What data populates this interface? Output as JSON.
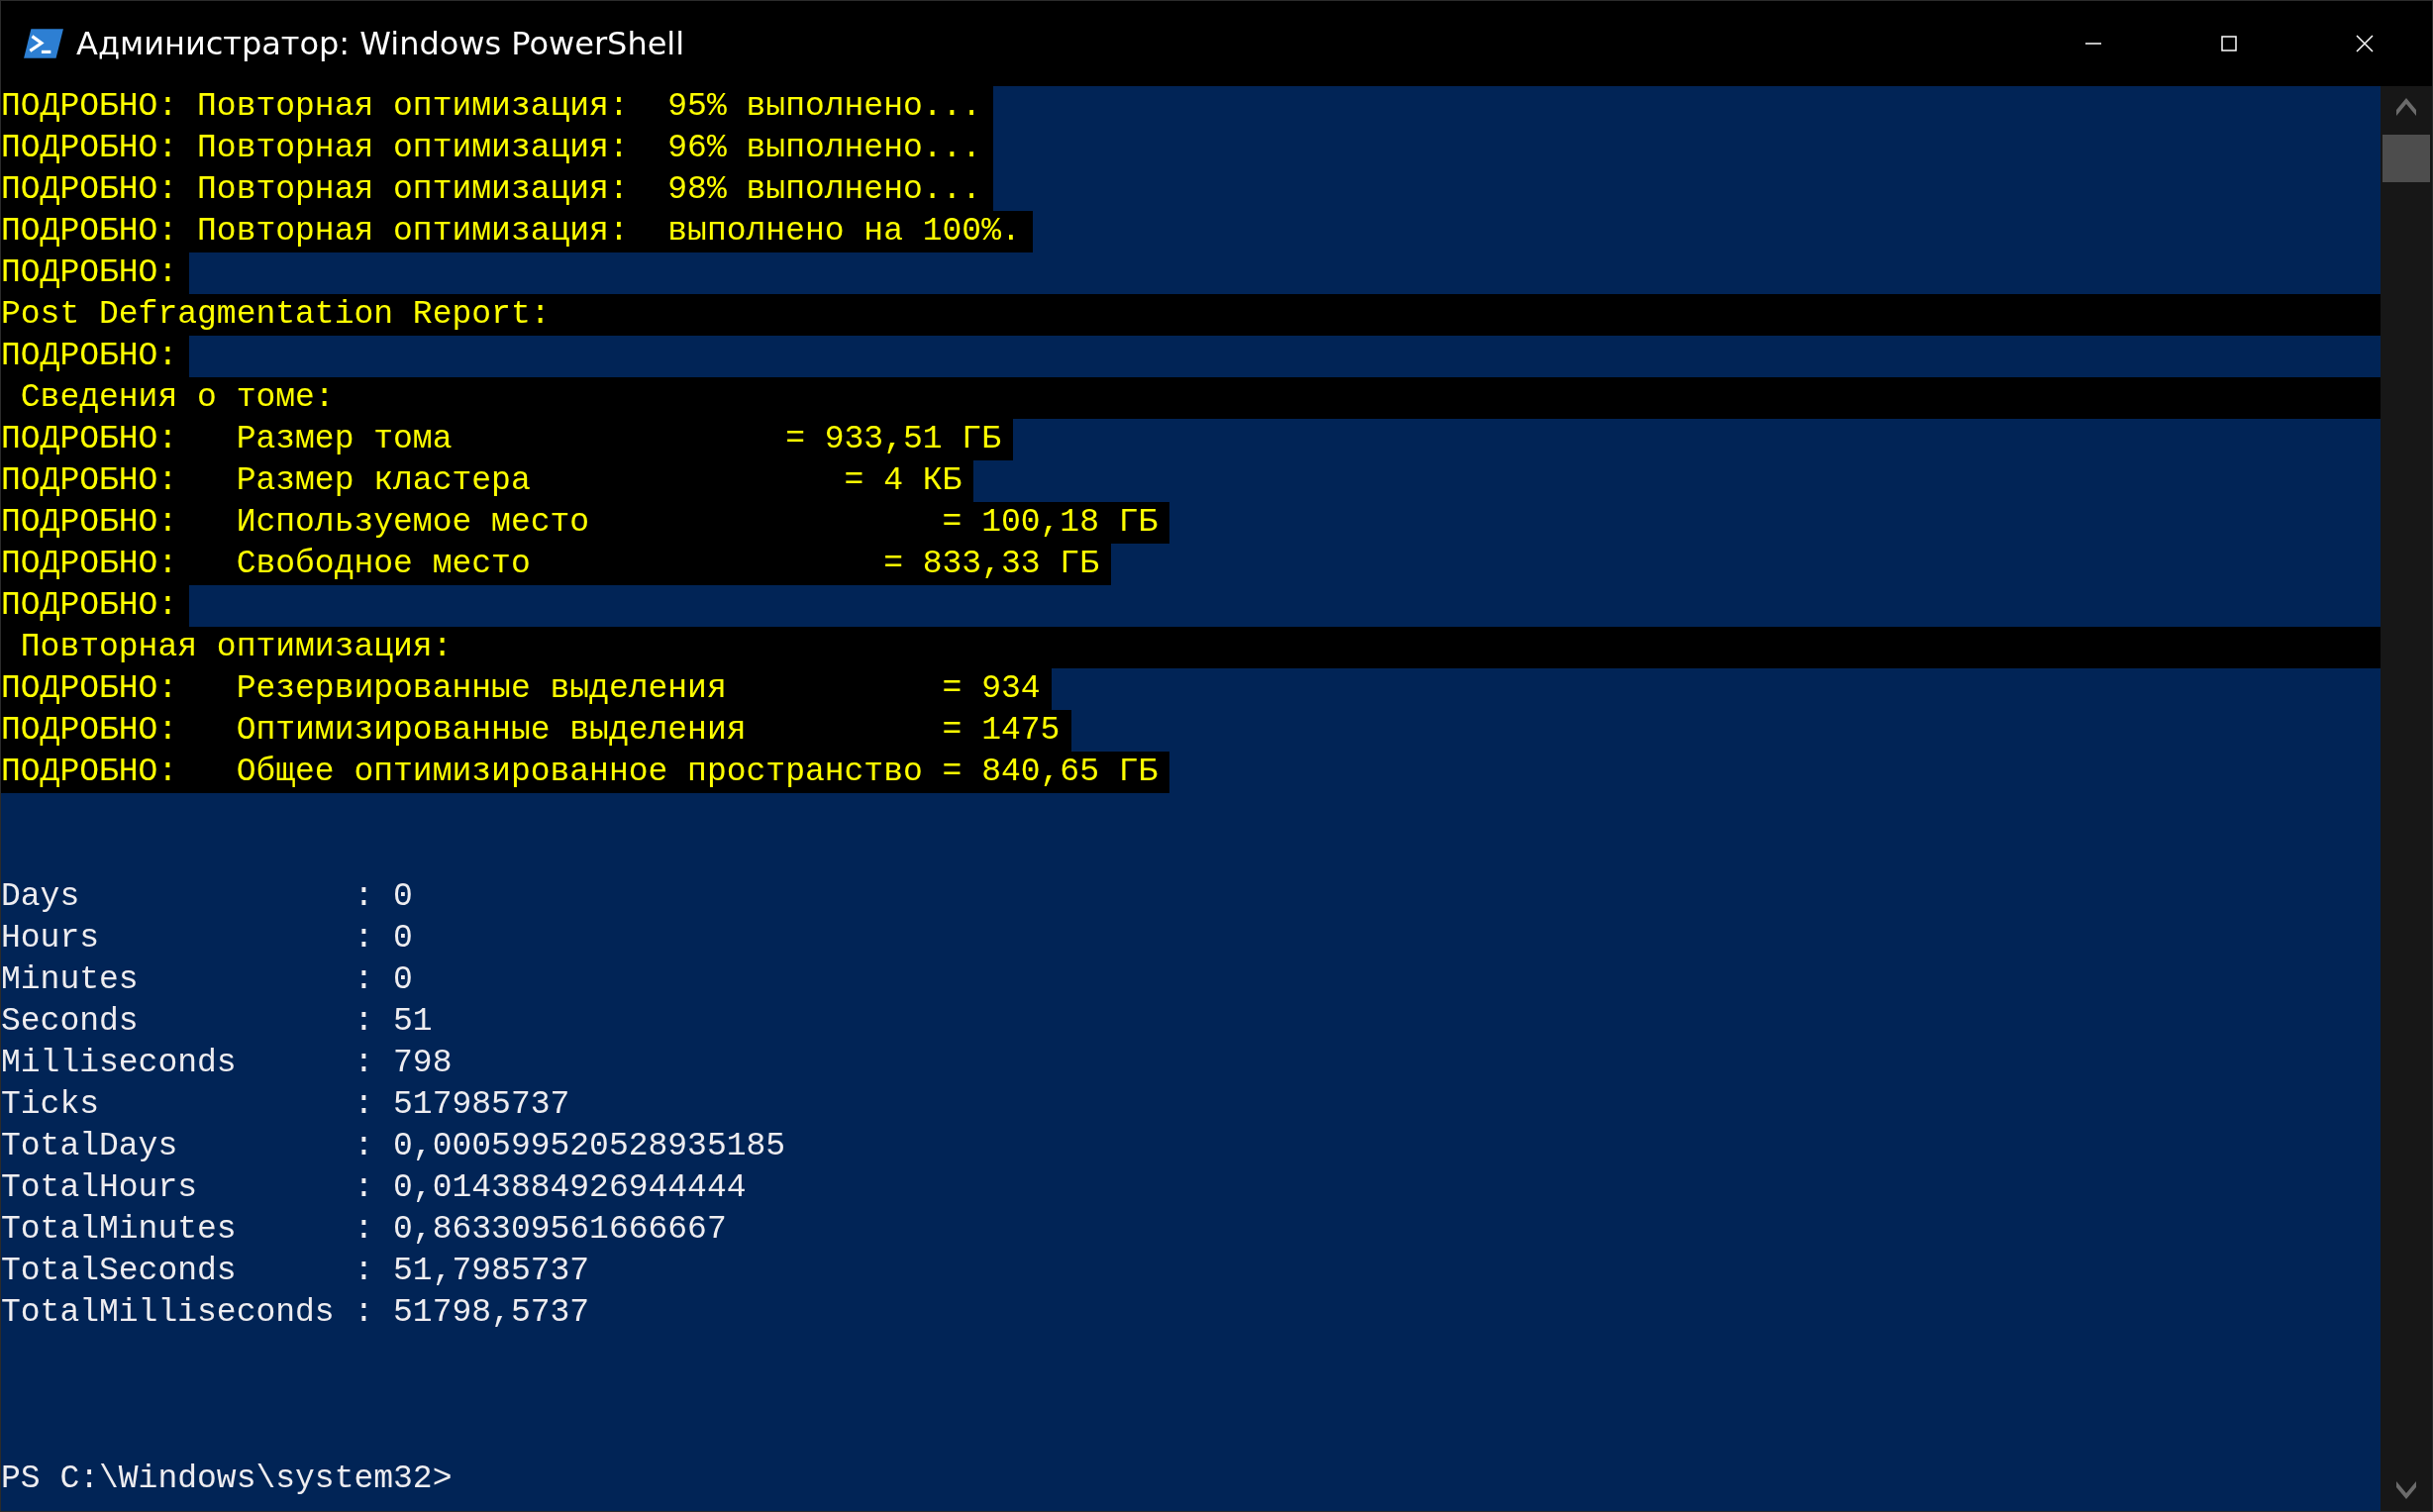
{
  "window": {
    "title": "Администратор: Windows PowerShell"
  },
  "console": {
    "lines": [
      {
        "kind": "verbose",
        "text": "ПОДРОБНО: Повторная оптимизация:  95% выполнено..."
      },
      {
        "kind": "verbose",
        "text": "ПОДРОБНО: Повторная оптимизация:  96% выполнено..."
      },
      {
        "kind": "verbose",
        "text": "ПОДРОБНО: Повторная оптимизация:  98% выполнено..."
      },
      {
        "kind": "verbose",
        "text": "ПОДРОБНО: Повторная оптимизация:  выполнено на 100%."
      },
      {
        "kind": "verbose",
        "text": "ПОДРОБНО:"
      },
      {
        "kind": "heading",
        "text": "Post Defragmentation Report:"
      },
      {
        "kind": "verbose",
        "text": "ПОДРОБНО:"
      },
      {
        "kind": "heading",
        "text": " Сведения о томе:"
      },
      {
        "kind": "verbose",
        "text": "ПОДРОБНО:   Размер тома                 = 933,51 ГБ"
      },
      {
        "kind": "verbose",
        "text": "ПОДРОБНО:   Размер кластера                = 4 КБ"
      },
      {
        "kind": "verbose",
        "text": "ПОДРОБНО:   Используемое место                  = 100,18 ГБ"
      },
      {
        "kind": "verbose",
        "text": "ПОДРОБНО:   Свободное место                  = 833,33 ГБ"
      },
      {
        "kind": "verbose",
        "text": "ПОДРОБНО:"
      },
      {
        "kind": "heading",
        "text": " Повторная оптимизация:"
      },
      {
        "kind": "verbose",
        "text": "ПОДРОБНО:   Резервированные выделения           = 934"
      },
      {
        "kind": "verbose",
        "text": "ПОДРОБНО:   Оптимизированные выделения          = 1475"
      },
      {
        "kind": "verbose",
        "text": "ПОДРОБНО:   Общее оптимизированное пространство = 840,65 ГБ"
      },
      {
        "kind": "blank"
      },
      {
        "kind": "blank"
      },
      {
        "kind": "output",
        "text": "Days              : 0"
      },
      {
        "kind": "output",
        "text": "Hours             : 0"
      },
      {
        "kind": "output",
        "text": "Minutes           : 0"
      },
      {
        "kind": "output",
        "text": "Seconds           : 51"
      },
      {
        "kind": "output",
        "text": "Milliseconds      : 798"
      },
      {
        "kind": "output",
        "text": "Ticks             : 517985737"
      },
      {
        "kind": "output",
        "text": "TotalDays         : 0,000599520528935185"
      },
      {
        "kind": "output",
        "text": "TotalHours        : 0,0143884926944444"
      },
      {
        "kind": "output",
        "text": "TotalMinutes      : 0,863309561666667"
      },
      {
        "kind": "output",
        "text": "TotalSeconds      : 51,7985737"
      },
      {
        "kind": "output",
        "text": "TotalMilliseconds : 51798,5737"
      },
      {
        "kind": "blank"
      },
      {
        "kind": "blank"
      },
      {
        "kind": "blank"
      },
      {
        "kind": "prompt",
        "text": "PS C:\\Windows\\system32>"
      }
    ]
  }
}
